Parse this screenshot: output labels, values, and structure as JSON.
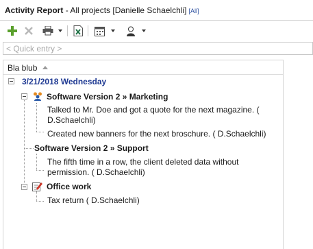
{
  "title": {
    "bold": "Activity Report",
    "rest": " - All projects [Danielle Schaelchli]",
    "all_link": "[All]"
  },
  "toolbar": {
    "icons": [
      "plus-icon",
      "delete-icon",
      "print-icon",
      "excel-icon",
      "calendar-icon",
      "user-icon"
    ],
    "colors": {
      "plus": "#5aa02c",
      "delete": "#b8b8b8",
      "excel": "#1e7145"
    }
  },
  "quick_entry": {
    "placeholder": "< Quick entry >"
  },
  "list": {
    "column_header": "Bla blub",
    "date": "3/21/2018 Wednesday",
    "groups": [
      {
        "title": "Software Version 2 » Marketing",
        "icon": "people-icon",
        "entries": [
          {
            "line1": "Talked to Mr. Doe and got a quote for the next magazine. (",
            "line2": "D.Schaelchli)"
          },
          {
            "line1": "Created new banners for the next broschure. ( D.Schaelchli)"
          }
        ]
      },
      {
        "title": "Software Version 2 » Support",
        "entries": [
          {
            "line1": "The fifth time in a row, the client deleted data without",
            "line2": "permission. ( D.Schaelchli)"
          }
        ]
      },
      {
        "title": "Office work",
        "icon": "notepad-pencil-icon",
        "entries": [
          {
            "line1": "Tax return ( D.Schaelchli)"
          }
        ]
      }
    ]
  }
}
